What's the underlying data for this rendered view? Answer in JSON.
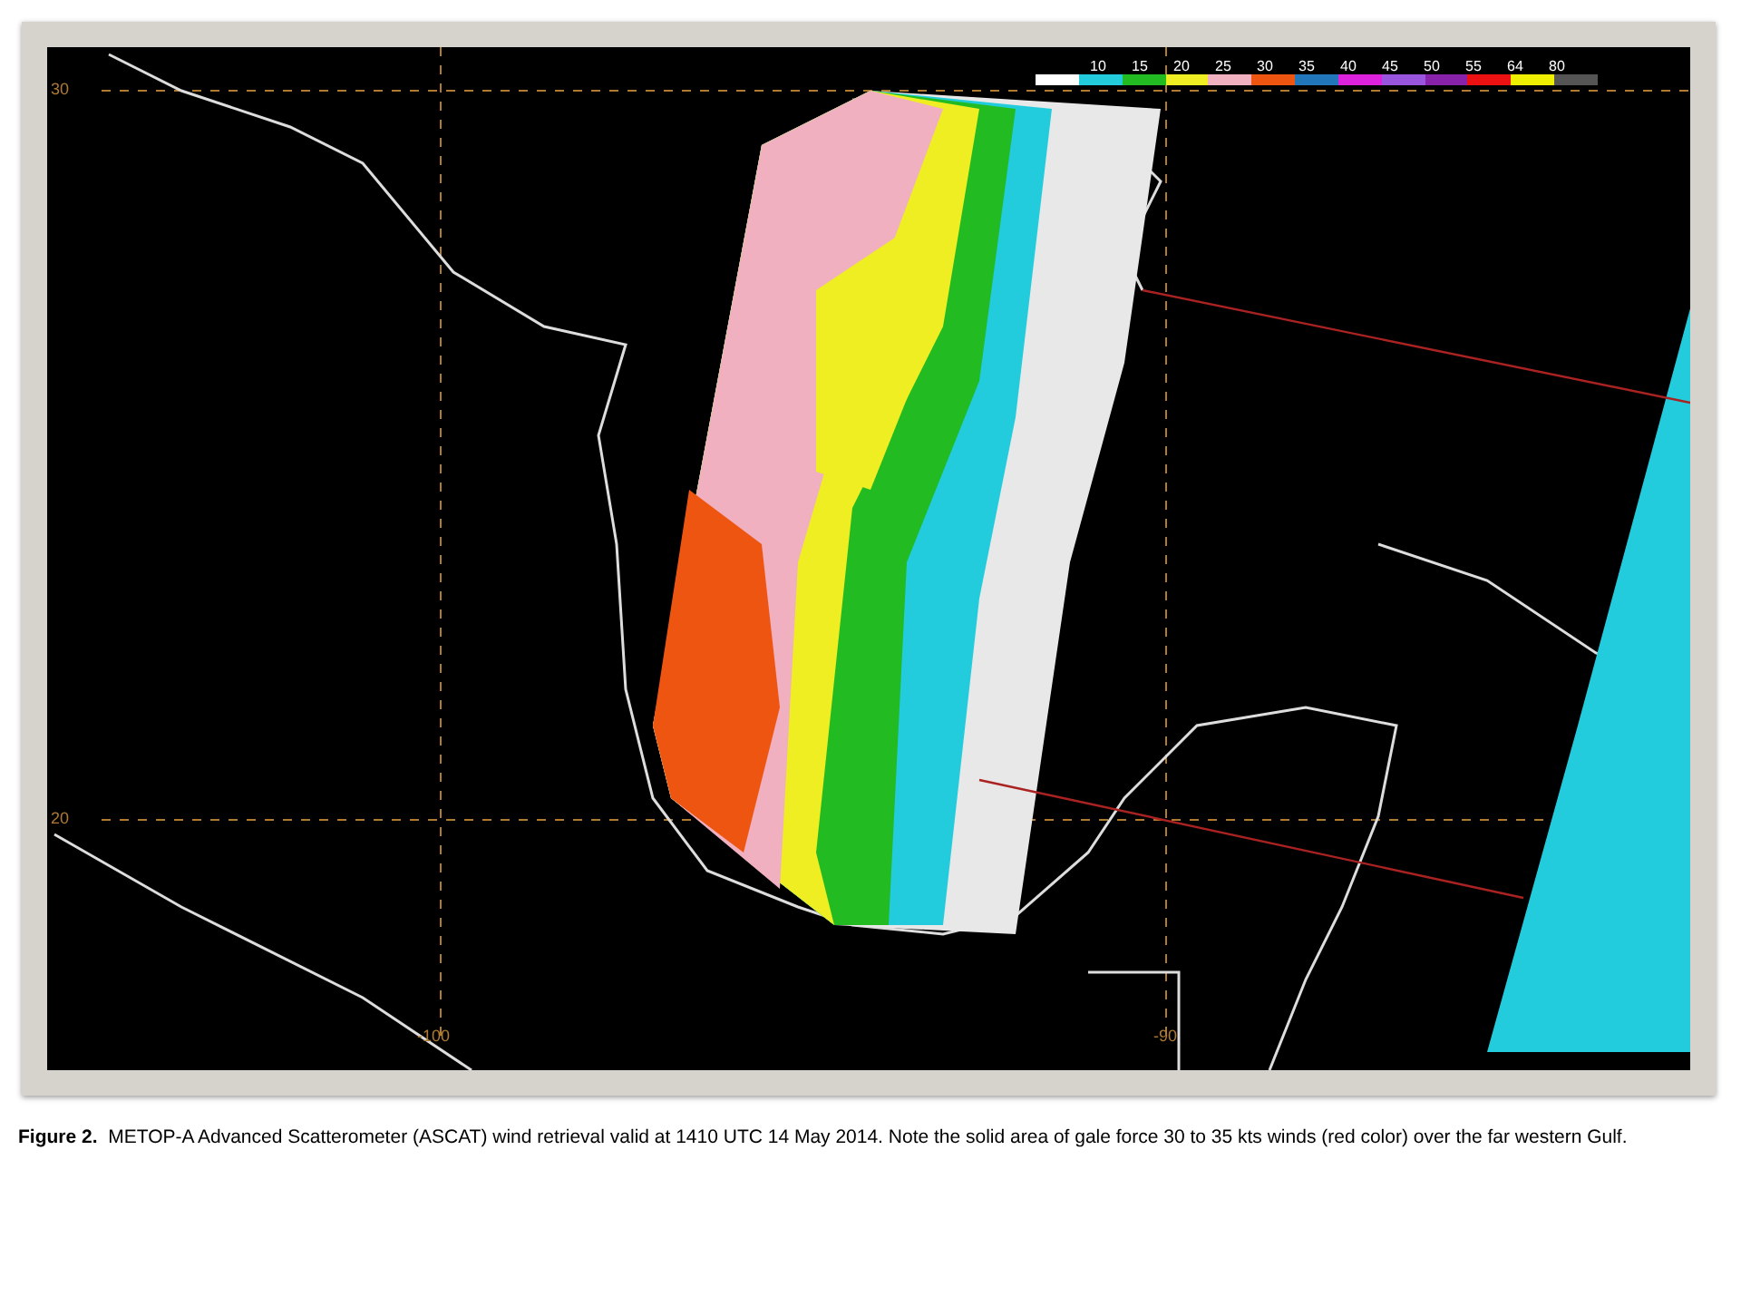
{
  "map": {
    "lat_labels": [
      "30",
      "20"
    ],
    "lon_labels": [
      "-100",
      "-90"
    ],
    "legend": {
      "labels": [
        "10",
        "15",
        "20",
        "25",
        "30",
        "35",
        "40",
        "45",
        "50",
        "55",
        "64",
        "80"
      ],
      "swatches": [
        {
          "color": "#ffffff"
        },
        {
          "color": "#22ccdd"
        },
        {
          "color": "#22bb22"
        },
        {
          "color": "#eeee22"
        },
        {
          "color": "#f0b0c0"
        },
        {
          "color": "#ee5511"
        },
        {
          "color": "#2277bb"
        },
        {
          "color": "#dd22dd"
        },
        {
          "color": "#9955dd"
        },
        {
          "color": "#8822aa"
        },
        {
          "color": "#ee1111"
        },
        {
          "color": "#eeee00"
        },
        {
          "color": "#555555"
        }
      ]
    }
  },
  "caption": {
    "label": "Figure 2.",
    "text": "METOP-A Advanced Scatterometer (ASCAT) wind retrieval valid at 1410 UTC 14 May 2014. Note the solid area of gale force 30 to 35 kts winds (red color) over the far western Gulf."
  }
}
